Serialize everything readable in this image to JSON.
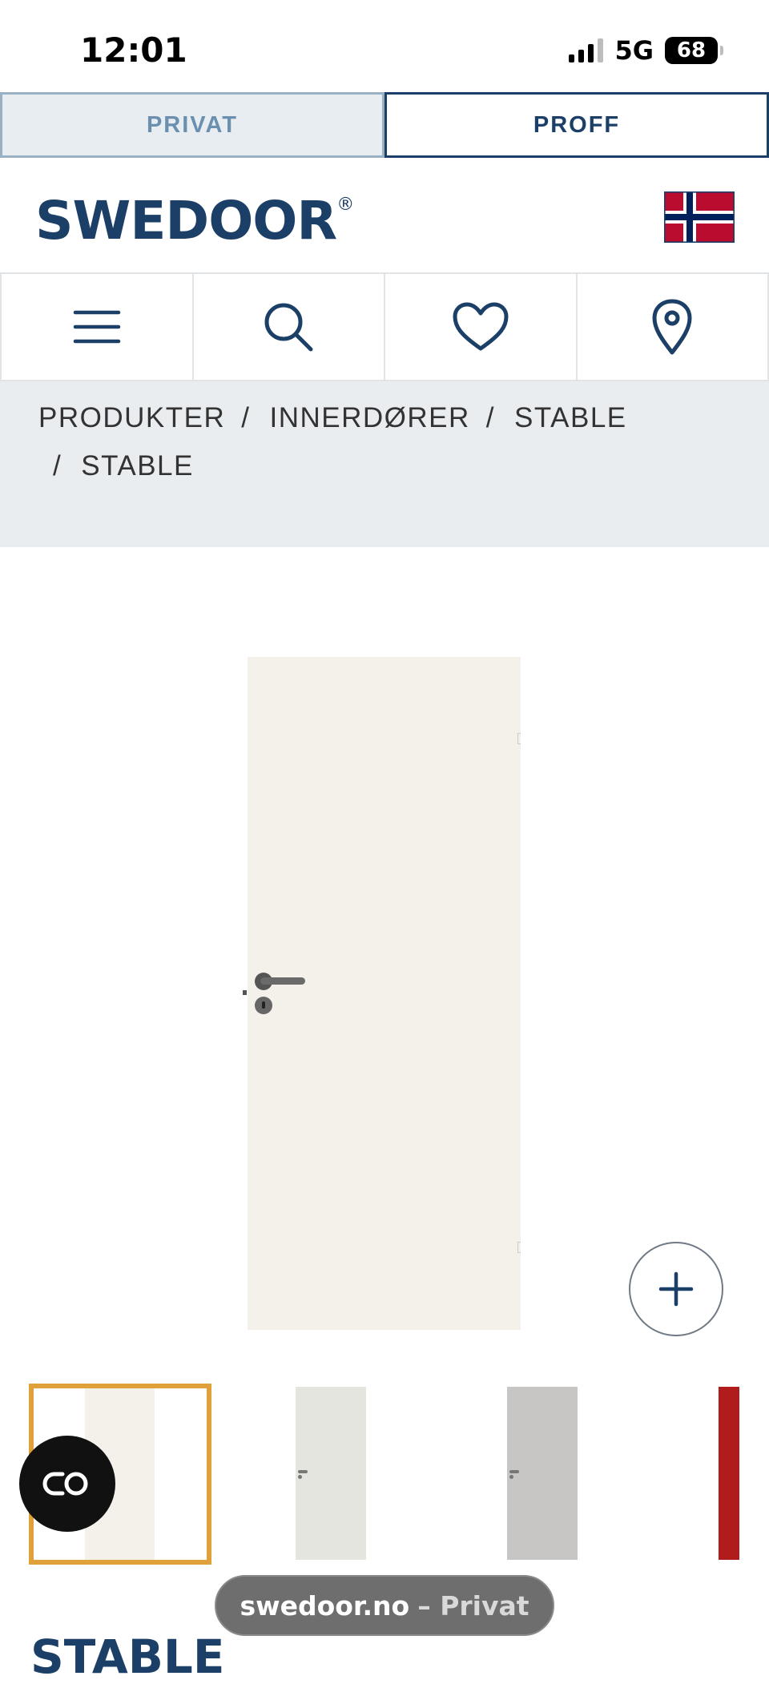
{
  "status_bar": {
    "time": "12:01",
    "network": "5G",
    "battery": "68"
  },
  "audience_toggle": {
    "privat_label": "PRIVAT",
    "proff_label": "PROFF",
    "active": "PROFF"
  },
  "header": {
    "logo_text": "SWEDOOR",
    "logo_mark": "®",
    "flag": "norway-flag"
  },
  "icon_nav": [
    {
      "icon": "menu-icon"
    },
    {
      "icon": "search-icon"
    },
    {
      "icon": "heart-icon"
    },
    {
      "icon": "location-pin-icon"
    }
  ],
  "breadcrumb": {
    "items": [
      "PRODUKTER",
      "INNERDØRER",
      "STABLE",
      "STABLE"
    ],
    "separator": "/"
  },
  "product_gallery": {
    "zoom_icon": "plus-icon",
    "thumbnails": [
      {
        "color": "#f4f0ea",
        "selected": true
      },
      {
        "color": "#e4e5df",
        "selected": false
      },
      {
        "color": "#c7c6c4",
        "selected": false
      },
      {
        "color": "#b01c1c",
        "selected": false
      }
    ],
    "selected_border_color": "#e0a03a"
  },
  "chat_button": {
    "icon": "chat-link-icon"
  },
  "browser": {
    "url": "swedoor.no",
    "url_suffix": "– Privat"
  },
  "product": {
    "title": "STABLE"
  },
  "colors": {
    "brand": "#1b3f66",
    "accent": "#e0a03a"
  }
}
